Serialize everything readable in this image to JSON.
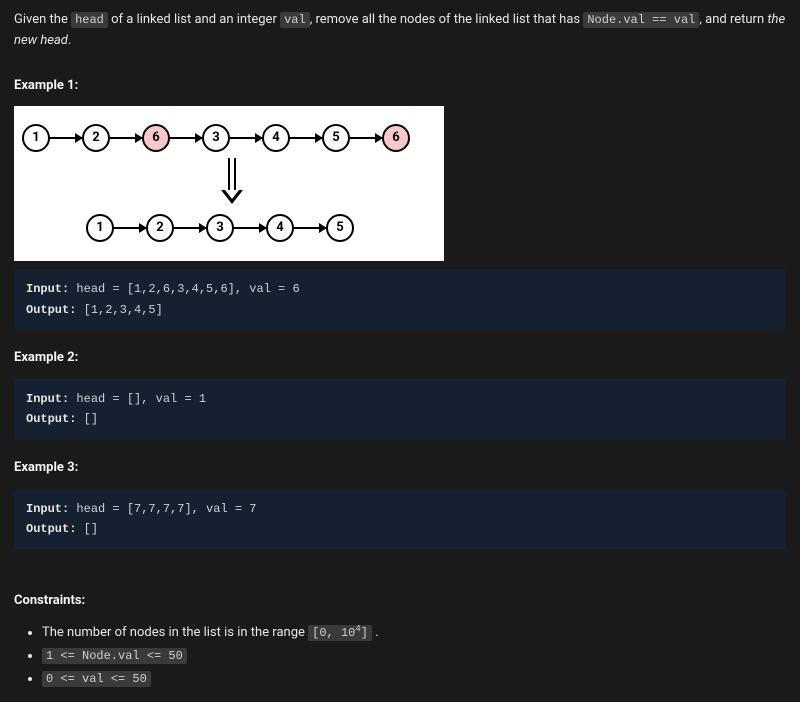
{
  "description": {
    "pre1": "Given the ",
    "code1": "head",
    "mid1": " of a linked list and an integer ",
    "code2": "val",
    "mid2": ", remove all the nodes of the linked list that has ",
    "code3": "Node.val == val",
    "mid3": ", and return ",
    "emph": "the new head",
    "post": "."
  },
  "diagram": {
    "row1": [
      {
        "val": "1",
        "removed": false
      },
      {
        "val": "2",
        "removed": false
      },
      {
        "val": "6",
        "removed": true
      },
      {
        "val": "3",
        "removed": false
      },
      {
        "val": "4",
        "removed": false
      },
      {
        "val": "5",
        "removed": false
      },
      {
        "val": "6",
        "removed": true
      }
    ],
    "row2": [
      {
        "val": "1"
      },
      {
        "val": "2"
      },
      {
        "val": "3"
      },
      {
        "val": "4"
      },
      {
        "val": "5"
      }
    ]
  },
  "examples": [
    {
      "title": "Example 1:",
      "input": "head = [1,2,6,3,4,5,6], val = 6",
      "output": "[1,2,3,4,5]"
    },
    {
      "title": "Example 2:",
      "input": "head = [], val = 1",
      "output": "[]"
    },
    {
      "title": "Example 3:",
      "input": "head = [7,7,7,7], val = 7",
      "output": "[]"
    }
  ],
  "labels": {
    "input": "Input:",
    "output": "Output:",
    "constraints": "Constraints:"
  },
  "constraints": {
    "c1_pre": "The number of nodes in the list is in the range ",
    "c1_code": "[0, 10⁴]",
    "c1_post": " .",
    "c2": "1 <= Node.val <= 50",
    "c3": "0 <= val <= 50"
  }
}
